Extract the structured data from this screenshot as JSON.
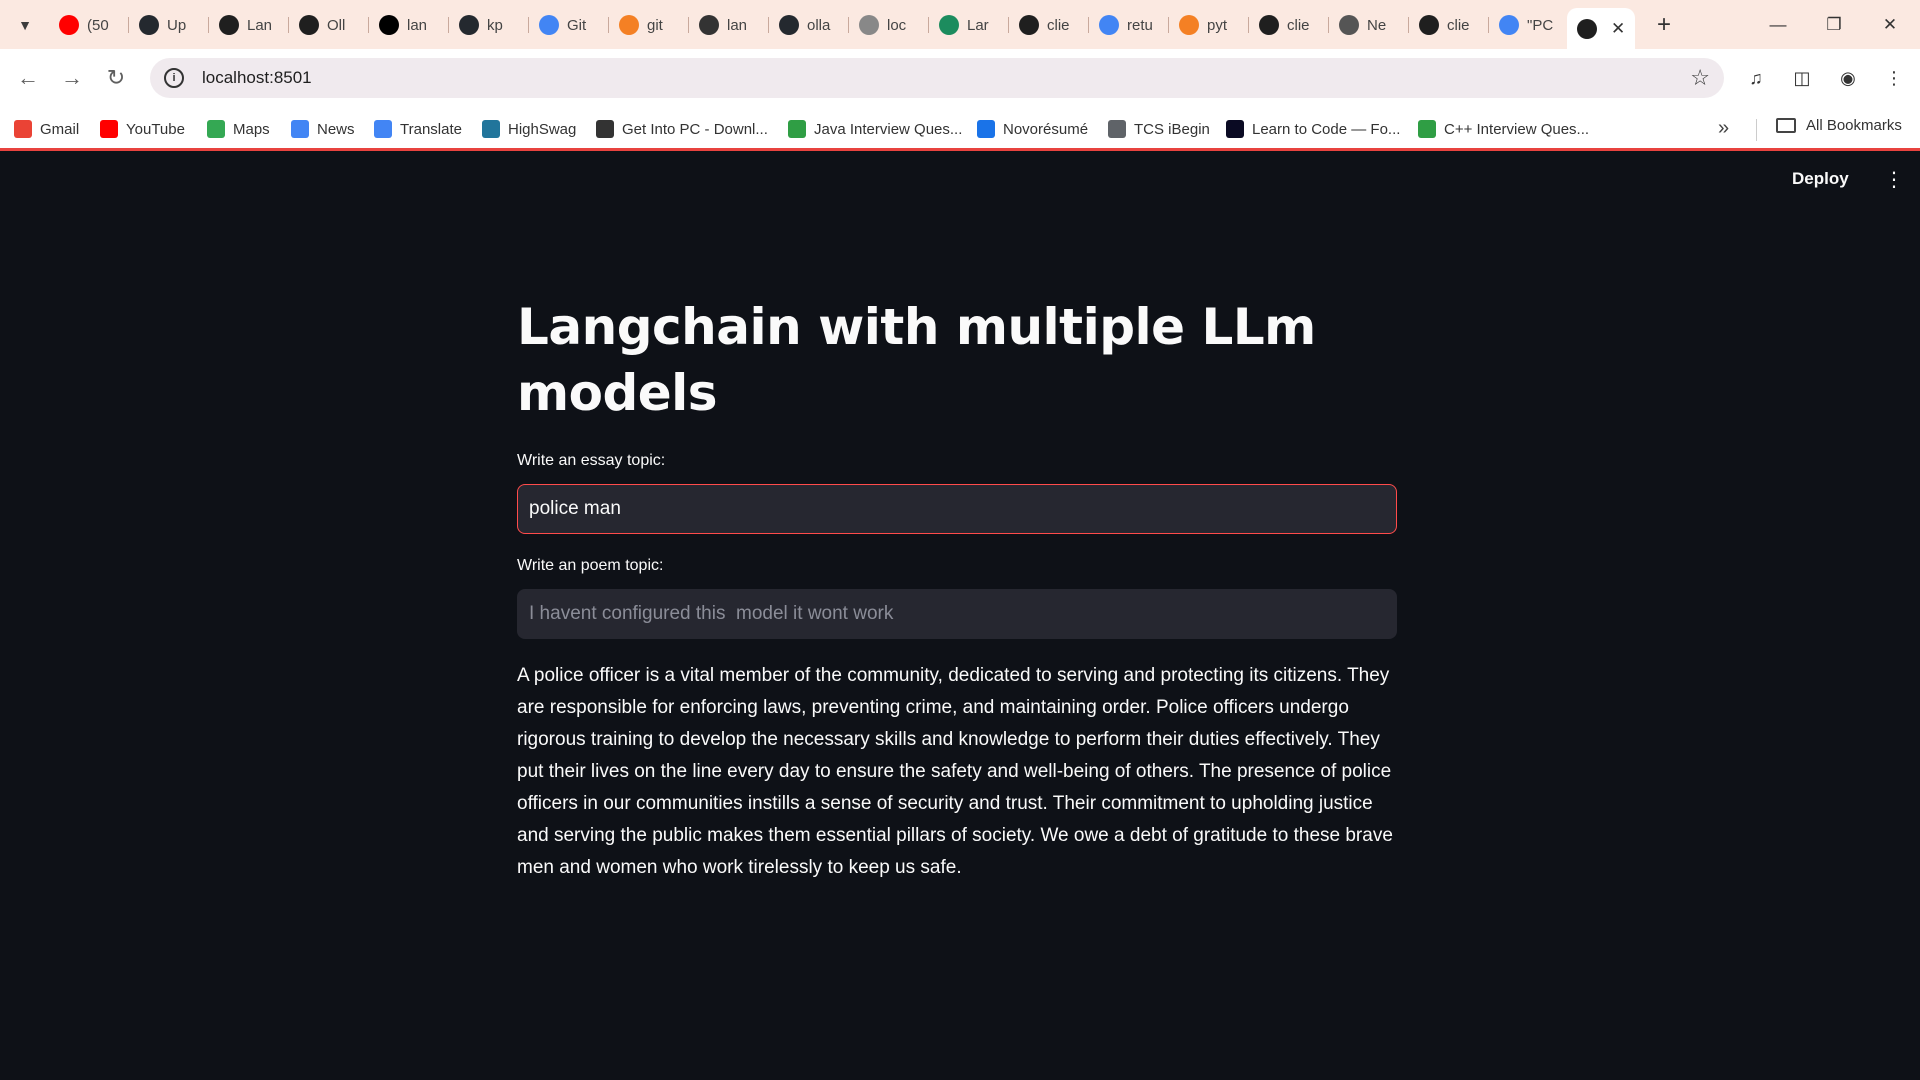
{
  "browser": {
    "tabs": [
      {
        "label": "(50",
        "icon": "youtube-icon",
        "color": "#ff0000"
      },
      {
        "label": "Up",
        "icon": "github-icon",
        "color": "#24292f"
      },
      {
        "label": "Lan",
        "icon": "ollama-icon",
        "color": "#1f1f1f"
      },
      {
        "label": "Oll",
        "icon": "ollama-icon",
        "color": "#1f1f1f"
      },
      {
        "label": "lan",
        "icon": "x-icon",
        "color": "#000000"
      },
      {
        "label": "kp",
        "icon": "github-icon",
        "color": "#24292f"
      },
      {
        "label": "Git",
        "icon": "google-icon",
        "color": "#4285f4"
      },
      {
        "label": "git",
        "icon": "stackoverflow-icon",
        "color": "#f48024"
      },
      {
        "label": "lan",
        "icon": "docs-icon",
        "color": "#333333"
      },
      {
        "label": "olla",
        "icon": "github-icon",
        "color": "#24292f"
      },
      {
        "label": "loc",
        "icon": "globe-icon",
        "color": "#888888"
      },
      {
        "label": "Lar",
        "icon": "langchain-icon",
        "color": "#1c8c5e"
      },
      {
        "label": "clie",
        "icon": "ollama-icon",
        "color": "#1f1f1f"
      },
      {
        "label": "retu",
        "icon": "google-icon",
        "color": "#4285f4"
      },
      {
        "label": "pyt",
        "icon": "stackoverflow-icon",
        "color": "#f48024"
      },
      {
        "label": "clie",
        "icon": "ollama-icon",
        "color": "#1f1f1f"
      },
      {
        "label": "Ne",
        "icon": "globe-icon",
        "color": "#555555"
      },
      {
        "label": "clie",
        "icon": "ollama-icon",
        "color": "#1f1f1f"
      },
      {
        "label": "\"PC",
        "icon": "google-icon",
        "color": "#4285f4"
      }
    ],
    "url": "localhost:8501",
    "bookmarks": [
      {
        "label": "Gmail",
        "icon": "gmail-icon",
        "color": "#ea4335"
      },
      {
        "label": "YouTube",
        "icon": "youtube-icon",
        "color": "#ff0000"
      },
      {
        "label": "Maps",
        "icon": "maps-icon",
        "color": "#34a853"
      },
      {
        "label": "News",
        "icon": "news-icon",
        "color": "#4285f4"
      },
      {
        "label": "Translate",
        "icon": "translate-icon",
        "color": "#4285f4"
      },
      {
        "label": "HighSwag",
        "icon": "wordpress-icon",
        "color": "#21759b"
      },
      {
        "label": "Get Into PC - Downl...",
        "icon": "getintopc-icon",
        "color": "#333333"
      },
      {
        "label": "Java Interview Ques...",
        "icon": "java-icon",
        "color": "#2f9e44"
      },
      {
        "label": "Novorésumé",
        "icon": "novoresume-icon",
        "color": "#1a73e8"
      },
      {
        "label": "TCS iBegin",
        "icon": "tcs-icon",
        "color": "#5f6368"
      },
      {
        "label": "Learn to Code — Fo...",
        "icon": "freecodecamp-icon",
        "color": "#0a0a23"
      },
      {
        "label": "C++ Interview Ques...",
        "icon": "cpp-icon",
        "color": "#2f9e44"
      }
    ],
    "all_bookmarks": "All Bookmarks",
    "accent": "#e8433f"
  },
  "app": {
    "deploy_label": "Deploy",
    "title": "Langchain with multiple LLm models",
    "essay_label": "Write an essay topic:",
    "essay_value": "police man",
    "poem_label": "Write an poem topic:",
    "poem_placeholder": "I havent configured this  model it wont work",
    "output": "A police officer is a vital member of the community, dedicated to serving and protecting its citizens. They are responsible for enforcing laws, preventing crime, and maintaining order. Police officers undergo rigorous training to develop the necessary skills and knowledge to perform their duties effectively. They put their lives on the line every day to ensure the safety and well-being of others. The presence of police officers in our communities instills a sense of security and trust. Their commitment to upholding justice and serving the public makes them essential pillars of society. We owe a debt of gratitude to these brave men and women who work tirelessly to keep us safe.",
    "background": "#0e1117",
    "input_bg": "#262730",
    "focus_color": "#ff4b4b"
  }
}
